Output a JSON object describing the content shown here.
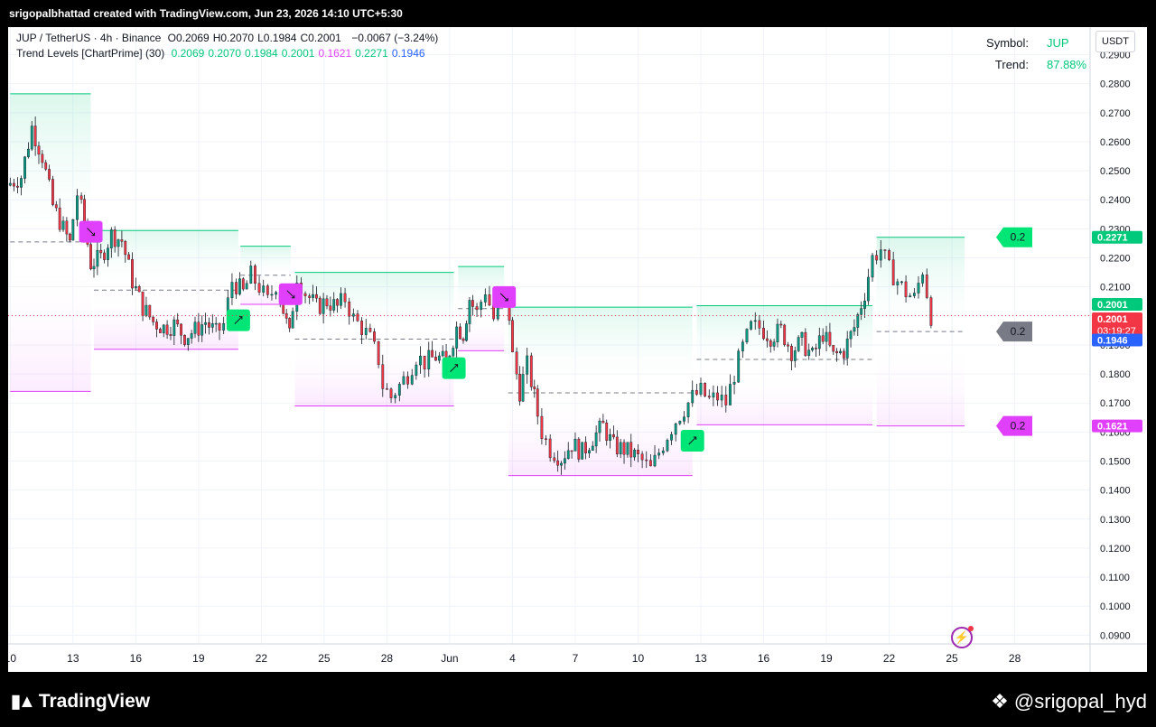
{
  "header": {
    "attribution": "srigopalbhattad created with TradingView.com, Jun 23, 2026 14:10 UTC+5:30"
  },
  "legend": {
    "symbol_line": "JUP / TetherUS · 4h · Binance",
    "ohlc": [
      {
        "label": "O",
        "value": "0.2069"
      },
      {
        "label": "H",
        "value": "0.2070"
      },
      {
        "label": "L",
        "value": "0.1984"
      },
      {
        "label": "C",
        "value": "0.2001"
      }
    ],
    "change": "−0.0067 (−3.24%)",
    "indicator_name": "Trend Levels [ChartPrime] (30)",
    "indicator_values": [
      {
        "value": "0.2069",
        "color": "#00c97b"
      },
      {
        "value": "0.2070",
        "color": "#00c97b"
      },
      {
        "value": "0.1984",
        "color": "#00c97b"
      },
      {
        "value": "0.2001",
        "color": "#00c97b"
      },
      {
        "value": "0.1621",
        "color": "#e040fb"
      },
      {
        "value": "0.2271",
        "color": "#00c97b"
      },
      {
        "value": "0.1946",
        "color": "#2962ff"
      }
    ]
  },
  "info_panel": {
    "symbol_label": "Symbol:",
    "symbol_value": "JUP",
    "trend_label": "Trend:",
    "trend_value": "87.88%"
  },
  "currency_button": "USDT",
  "footer": {
    "brand": "TradingView",
    "handle": "@srigopal_hyd"
  },
  "colors": {
    "up": "#089981",
    "down": "#f23645",
    "bull_level": "#00c97b",
    "bear_level": "#e040fb",
    "mid_level": "#787b86",
    "grid": "#f0f3fa"
  },
  "chart_data": {
    "type": "candlestick",
    "title": "JUP / TetherUS · 4h · Binance",
    "ylim": [
      0.087,
      0.2995
    ],
    "y_ticks": [
      "0.0900",
      "0.1000",
      "0.1100",
      "0.1200",
      "0.1300",
      "0.1400",
      "0.1500",
      "0.1600",
      "0.1700",
      "0.1800",
      "0.1900",
      "0.2000",
      "0.2100",
      "0.2200",
      "0.2300",
      "0.2400",
      "0.2500",
      "0.2600",
      "0.2700",
      "0.2800",
      "0.2900"
    ],
    "x_ticks": [
      {
        "label": "10",
        "t": 10
      },
      {
        "label": "13",
        "t": 13
      },
      {
        "label": "16",
        "t": 16
      },
      {
        "label": "19",
        "t": 19
      },
      {
        "label": "22",
        "t": 22
      },
      {
        "label": "25",
        "t": 25
      },
      {
        "label": "28",
        "t": 28
      },
      {
        "label": "Jun",
        "t": 31
      },
      {
        "label": "4",
        "t": 34
      },
      {
        "label": "7",
        "t": 37
      },
      {
        "label": "10",
        "t": 40
      },
      {
        "label": "13",
        "t": 43
      },
      {
        "label": "16",
        "t": 46
      },
      {
        "label": "19",
        "t": 49
      },
      {
        "label": "22",
        "t": 52
      },
      {
        "label": "25",
        "t": 55
      },
      {
        "label": "28",
        "t": 58
      }
    ],
    "x_unit": "days (May 10 = 10, Jun 1 = 32)",
    "x_range": [
      9.9,
      61.6
    ],
    "price_path": [
      [
        10.0,
        0.245
      ],
      [
        10.7,
        0.248
      ],
      [
        11.2,
        0.265
      ],
      [
        11.7,
        0.255
      ],
      [
        12.2,
        0.238
      ],
      [
        12.7,
        0.23
      ],
      [
        13.0,
        0.225
      ],
      [
        13.4,
        0.242
      ],
      [
        13.7,
        0.232
      ],
      [
        14.0,
        0.218
      ],
      [
        14.5,
        0.22
      ],
      [
        15.0,
        0.228
      ],
      [
        15.5,
        0.226
      ],
      [
        16.0,
        0.212
      ],
      [
        16.5,
        0.203
      ],
      [
        17.0,
        0.198
      ],
      [
        17.5,
        0.196
      ],
      [
        18.0,
        0.197
      ],
      [
        18.5,
        0.193
      ],
      [
        19.0,
        0.195
      ],
      [
        19.5,
        0.198
      ],
      [
        20.0,
        0.194
      ],
      [
        20.4,
        0.197
      ],
      [
        20.8,
        0.212
      ],
      [
        21.3,
        0.208
      ],
      [
        21.7,
        0.214
      ],
      [
        22.1,
        0.21
      ],
      [
        22.5,
        0.205
      ],
      [
        22.9,
        0.211
      ],
      [
        23.2,
        0.202
      ],
      [
        23.5,
        0.193
      ],
      [
        23.9,
        0.214
      ],
      [
        24.3,
        0.208
      ],
      [
        24.8,
        0.203
      ],
      [
        25.3,
        0.205
      ],
      [
        25.8,
        0.203
      ],
      [
        26.2,
        0.206
      ],
      [
        26.6,
        0.199
      ],
      [
        27.0,
        0.196
      ],
      [
        27.4,
        0.192
      ],
      [
        27.8,
        0.185
      ],
      [
        28.0,
        0.176
      ],
      [
        28.4,
        0.172
      ],
      [
        28.8,
        0.176
      ],
      [
        29.2,
        0.18
      ],
      [
        29.6,
        0.186
      ],
      [
        30.0,
        0.184
      ],
      [
        30.5,
        0.186
      ],
      [
        31.0,
        0.184
      ],
      [
        31.5,
        0.196
      ],
      [
        31.8,
        0.194
      ],
      [
        32.1,
        0.206
      ],
      [
        32.5,
        0.201
      ],
      [
        32.9,
        0.209
      ],
      [
        33.3,
        0.199
      ],
      [
        33.7,
        0.206
      ],
      [
        34.0,
        0.2
      ],
      [
        34.2,
        0.186
      ],
      [
        34.5,
        0.174
      ],
      [
        34.9,
        0.183
      ],
      [
        35.2,
        0.172
      ],
      [
        35.6,
        0.16
      ],
      [
        36.0,
        0.154
      ],
      [
        36.5,
        0.151
      ],
      [
        37.0,
        0.156
      ],
      [
        37.5,
        0.153
      ],
      [
        38.0,
        0.158
      ],
      [
        38.5,
        0.162
      ],
      [
        39.0,
        0.155
      ],
      [
        39.5,
        0.154
      ],
      [
        40.0,
        0.152
      ],
      [
        40.4,
        0.15
      ],
      [
        40.8,
        0.147
      ],
      [
        41.2,
        0.153
      ],
      [
        41.6,
        0.159
      ],
      [
        42.0,
        0.164
      ],
      [
        42.4,
        0.168
      ],
      [
        42.8,
        0.172
      ],
      [
        43.2,
        0.174
      ],
      [
        43.6,
        0.171
      ],
      [
        44.0,
        0.172
      ],
      [
        44.4,
        0.17
      ],
      [
        44.8,
        0.18
      ],
      [
        45.2,
        0.189
      ],
      [
        45.6,
        0.196
      ],
      [
        46.0,
        0.196
      ],
      [
        46.5,
        0.193
      ],
      [
        47.0,
        0.195
      ],
      [
        47.5,
        0.188
      ],
      [
        48.0,
        0.191
      ],
      [
        48.5,
        0.186
      ],
      [
        49.0,
        0.194
      ],
      [
        49.5,
        0.186
      ],
      [
        50.0,
        0.188
      ],
      [
        50.5,
        0.196
      ],
      [
        51.0,
        0.208
      ],
      [
        51.4,
        0.22
      ],
      [
        51.8,
        0.223
      ],
      [
        52.2,
        0.216
      ],
      [
        52.6,
        0.212
      ],
      [
        53.0,
        0.208
      ],
      [
        53.4,
        0.206
      ],
      [
        53.8,
        0.216
      ],
      [
        54.2,
        0.2
      ]
    ],
    "levels": [
      {
        "kind": "bull",
        "x1": 10.0,
        "x2": 13.85,
        "top": 0.2765,
        "bottom": 0.174,
        "mid": 0.2255
      },
      {
        "kind": "bear",
        "x1": 14.0,
        "x2": 20.9,
        "top": 0.2294,
        "bottom": 0.1885,
        "mid": 0.2089
      },
      {
        "kind": "bull",
        "x1": 21.0,
        "x2": 23.4,
        "top": 0.224,
        "bottom": 0.204,
        "mid": 0.214
      },
      {
        "kind": "bear",
        "x1": 23.6,
        "x2": 31.2,
        "top": 0.215,
        "bottom": 0.169,
        "mid": 0.192
      },
      {
        "kind": "bull",
        "x1": 31.4,
        "x2": 33.6,
        "top": 0.217,
        "bottom": 0.188,
        "mid": 0.2025
      },
      {
        "kind": "bear",
        "x1": 33.8,
        "x2": 42.6,
        "top": 0.203,
        "bottom": 0.145,
        "mid": 0.1735
      },
      {
        "kind": "bull",
        "x1": 42.8,
        "x2": 51.2,
        "top": 0.2035,
        "bottom": 0.1625,
        "mid": 0.185
      },
      {
        "kind": "bull",
        "x1": 51.4,
        "x2": 55.6,
        "top": 0.2271,
        "bottom": 0.1621,
        "mid": 0.1946
      }
    ],
    "signals": [
      {
        "kind": "bear",
        "x": 13.85,
        "y": 0.229
      },
      {
        "kind": "bull",
        "x": 20.9,
        "y": 0.1985
      },
      {
        "kind": "bear",
        "x": 23.4,
        "y": 0.2075
      },
      {
        "kind": "bull",
        "x": 31.2,
        "y": 0.182
      },
      {
        "kind": "bear",
        "x": 33.6,
        "y": 0.2065
      },
      {
        "kind": "bull",
        "x": 42.6,
        "y": 0.157
      }
    ],
    "level_labels": [
      {
        "text": "0.2",
        "price": 0.2271,
        "color": "#00e676"
      },
      {
        "text": "0.2",
        "price": 0.1946,
        "color": "#787b86"
      },
      {
        "text": "0.2",
        "price": 0.1621,
        "color": "#e040fb"
      }
    ],
    "price_tags": [
      {
        "text": "0.2271",
        "price": 0.2271,
        "bg": "#00c97b"
      },
      {
        "text": "0.2001",
        "price": 0.204,
        "bg": "#00c97b"
      },
      {
        "text": "0.2001",
        "sub": "03:19:27",
        "price": 0.199,
        "bg": "#f23645"
      },
      {
        "text": "0.1946",
        "price": 0.1917,
        "bg": "#2962ff"
      },
      {
        "text": "0.1621",
        "price": 0.1621,
        "bg": "#e040fb"
      }
    ],
    "last_price": 0.2001
  }
}
